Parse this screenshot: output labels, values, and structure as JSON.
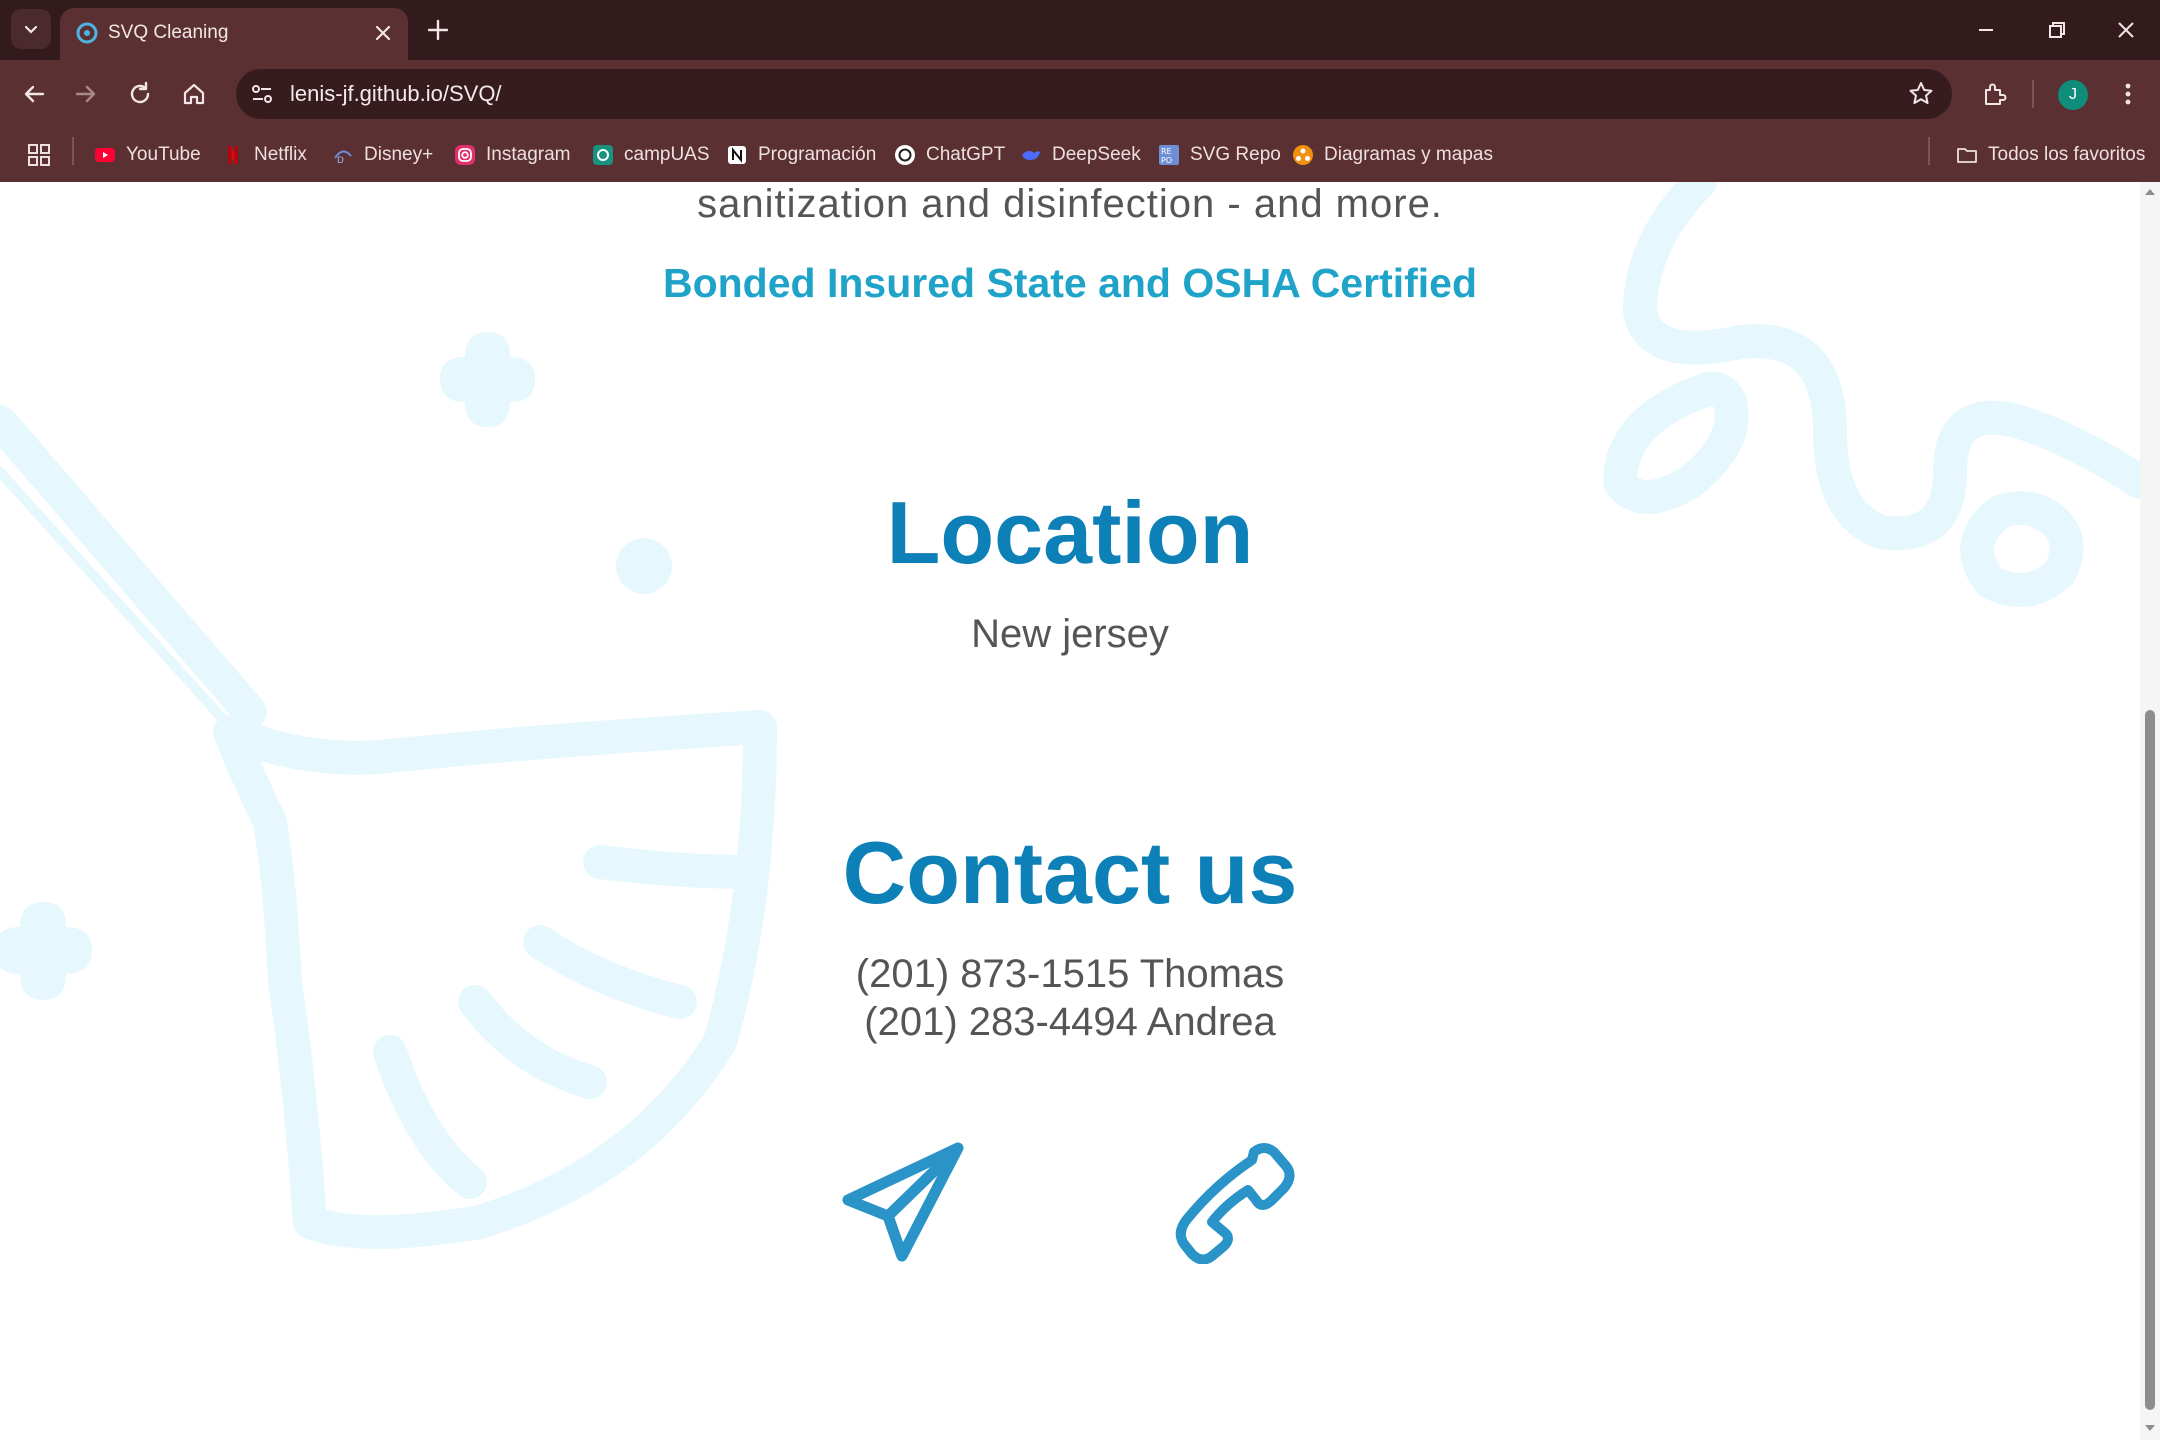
{
  "browser": {
    "tab": {
      "title": "SVQ Cleaning"
    },
    "url": "lenis-jf.github.io/SVQ/",
    "profile_initial": "J",
    "bookmarks": [
      {
        "label": "YouTube",
        "icon": "youtube-icon"
      },
      {
        "label": "Netflix",
        "icon": "netflix-icon"
      },
      {
        "label": "Disney+",
        "icon": "disney-icon"
      },
      {
        "label": "Instagram",
        "icon": "instagram-icon"
      },
      {
        "label": "campUAS",
        "icon": "campuas-icon"
      },
      {
        "label": "Programación",
        "icon": "notion-icon"
      },
      {
        "label": "ChatGPT",
        "icon": "chatgpt-icon"
      },
      {
        "label": "DeepSeek",
        "icon": "deepseek-icon"
      },
      {
        "label": "SVG Repo",
        "icon": "svgrepo-icon"
      },
      {
        "label": "Diagramas y mapas",
        "icon": "diagrams-icon"
      }
    ],
    "all_bookmarks_label": "Todos los favoritos"
  },
  "page": {
    "lead_text": "sanitization and disinfection - and more.",
    "certified_text": "Bonded Insured State and OSHA Certified",
    "location_heading": "Location",
    "location_text": "New jersey",
    "contact_heading": "Contact us",
    "phones": [
      "(201) 873-1515 Thomas",
      "(201) 283-4494 Andrea"
    ],
    "actions": [
      {
        "name": "send-message",
        "icon": "paper-plane-icon"
      },
      {
        "name": "call",
        "icon": "phone-icon"
      }
    ]
  },
  "colors": {
    "heading": "#0d80b8",
    "accent": "#1fa3c9",
    "icon": "#2a93c8",
    "body_text": "#555555",
    "bg_art": "#e6f8fd",
    "chrome_dark": "#331a1d",
    "chrome": "#5a3033"
  }
}
